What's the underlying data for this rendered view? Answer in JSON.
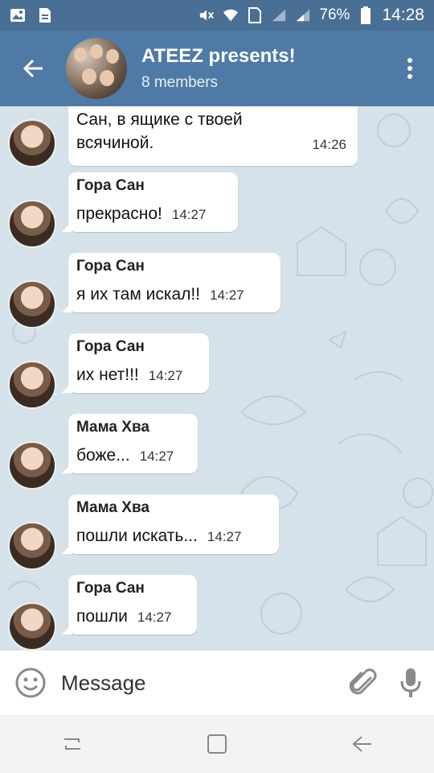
{
  "status_bar": {
    "battery_percent": "76%",
    "time": "14:28"
  },
  "header": {
    "title": "ATEEZ presents!",
    "subtitle": "8 members"
  },
  "messages": [
    {
      "sender": "",
      "text": "Сан, в ящике с твоей всячиной.",
      "time": "14:26"
    },
    {
      "sender": "Гора Сан",
      "text": "прекрасно!",
      "time": "14:27"
    },
    {
      "sender": "Гора Сан",
      "text": "я их там искал!!",
      "time": "14:27"
    },
    {
      "sender": "Гора Сан",
      "text": "их нет!!!",
      "time": "14:27"
    },
    {
      "sender": "Мама Хва",
      "text": "боже...",
      "time": "14:27"
    },
    {
      "sender": "Мама Хва",
      "text": "пошли искать...",
      "time": "14:27"
    },
    {
      "sender": "Гора Сан",
      "text": "пошли",
      "time": "14:27"
    }
  ],
  "input": {
    "placeholder": "Message"
  },
  "colors": {
    "header": "#4f7aa6",
    "status_bar": "#4a6f94",
    "chat_bg": "#d6e2ea",
    "bubble": "#ffffff"
  }
}
